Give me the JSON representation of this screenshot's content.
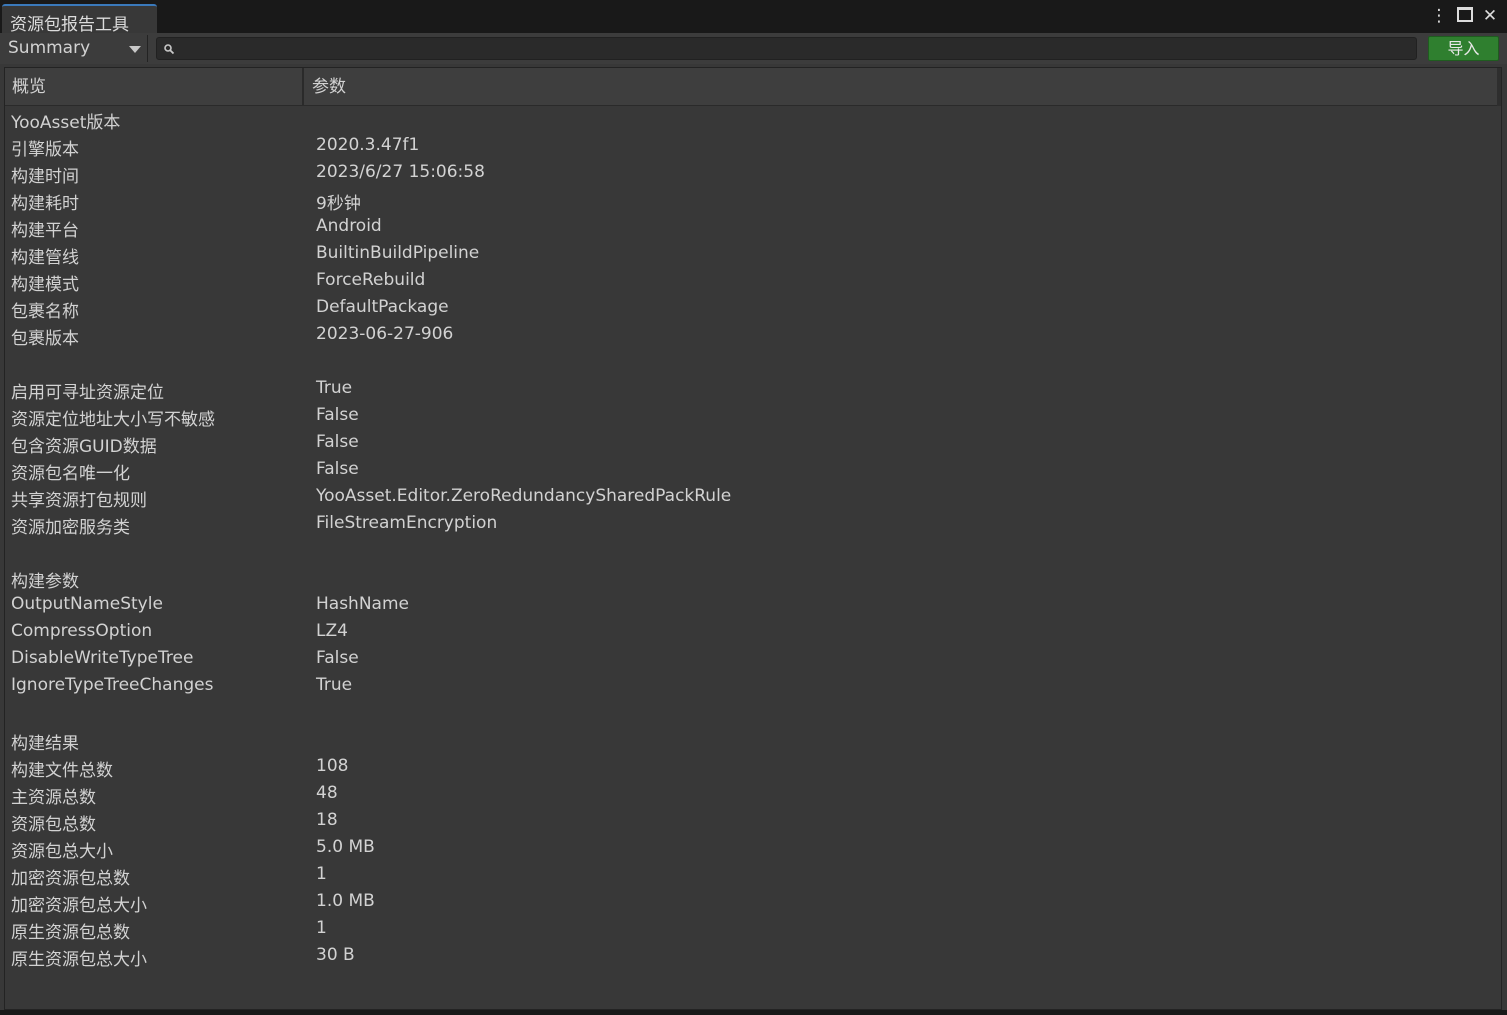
{
  "window": {
    "tab_title": "资源包报告工具",
    "controls": {
      "menu": "⋮",
      "close": "✕"
    }
  },
  "toolbar": {
    "view_mode": "Summary",
    "search": {
      "value": "",
      "placeholder": ""
    },
    "import_label": "导入",
    "colors": {
      "import_bg": "#2f7f2f"
    }
  },
  "table": {
    "columns": [
      "概览",
      "参数"
    ],
    "rows": [
      {
        "name": "YooAsset版本",
        "value": ""
      },
      {
        "name": "引擎版本",
        "value": "2020.3.47f1"
      },
      {
        "name": "构建时间",
        "value": "2023/6/27 15:06:58"
      },
      {
        "name": "构建耗时",
        "value": "9秒钟"
      },
      {
        "name": "构建平台",
        "value": "Android"
      },
      {
        "name": "构建管线",
        "value": "BuiltinBuildPipeline"
      },
      {
        "name": "构建模式",
        "value": "ForceRebuild"
      },
      {
        "name": "包裹名称",
        "value": "DefaultPackage"
      },
      {
        "name": "包裹版本",
        "value": "2023-06-27-906"
      },
      {
        "name": "",
        "value": ""
      },
      {
        "name": "启用可寻址资源定位",
        "value": "True"
      },
      {
        "name": "资源定位地址大小写不敏感",
        "value": "False"
      },
      {
        "name": "包含资源GUID数据",
        "value": "False"
      },
      {
        "name": "资源包名唯一化",
        "value": "False"
      },
      {
        "name": "共享资源打包规则",
        "value": "YooAsset.Editor.ZeroRedundancySharedPackRule"
      },
      {
        "name": "资源加密服务类",
        "value": "FileStreamEncryption"
      },
      {
        "name": "",
        "value": ""
      },
      {
        "name": "构建参数",
        "value": ""
      },
      {
        "name": "OutputNameStyle",
        "value": "HashName"
      },
      {
        "name": "CompressOption",
        "value": "LZ4"
      },
      {
        "name": "DisableWriteTypeTree",
        "value": "False"
      },
      {
        "name": "IgnoreTypeTreeChanges",
        "value": "True"
      },
      {
        "name": "",
        "value": ""
      },
      {
        "name": "构建结果",
        "value": ""
      },
      {
        "name": "构建文件总数",
        "value": "108"
      },
      {
        "name": "主资源总数",
        "value": "48"
      },
      {
        "name": "资源包总数",
        "value": "18"
      },
      {
        "name": "资源包总大小",
        "value": "5.0 MB"
      },
      {
        "name": "加密资源包总数",
        "value": "1"
      },
      {
        "name": "加密资源包总大小",
        "value": "1.0 MB"
      },
      {
        "name": "原生资源包总数",
        "value": "1"
      },
      {
        "name": "原生资源包总大小",
        "value": "30 B"
      }
    ]
  }
}
